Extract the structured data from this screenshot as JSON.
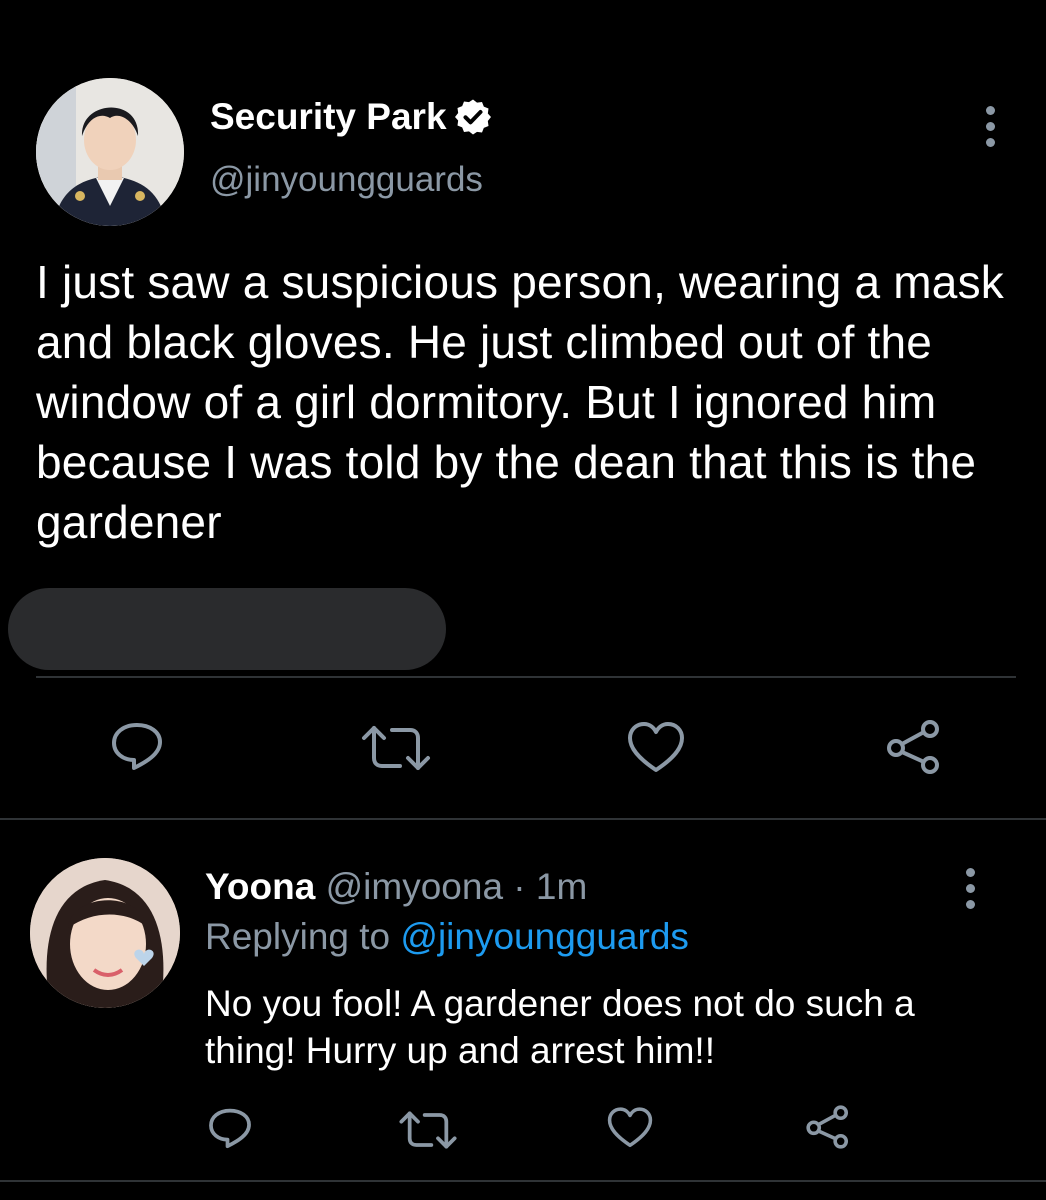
{
  "tweet": {
    "author_name": "Security Park",
    "author_handle": "@jinyoungguards",
    "text": "I just saw a suspicious person, wearing a mask and black gloves. He just climbed out of the window of a girl dormitory. But I ignored him because I was told by the dean that this is the gardener",
    "icons": [
      "verified-icon",
      "more-icon",
      "reply-icon",
      "retweet-icon",
      "like-icon",
      "share-icon"
    ]
  },
  "reply": {
    "author_name": "Yoona",
    "author_handle": "@imyoona",
    "separator": " · ",
    "time": "1m",
    "replying_prefix": "Replying to ",
    "replying_to": "@jinyoungguards",
    "text": "No you fool! A gardener does not do such a thing! Hurry up and arrest him!!"
  },
  "colors": {
    "background": "#000000",
    "text": "#ffffff",
    "secondary": "#8b98a5",
    "link": "#1d9bf0",
    "divider": "#2f3336"
  }
}
